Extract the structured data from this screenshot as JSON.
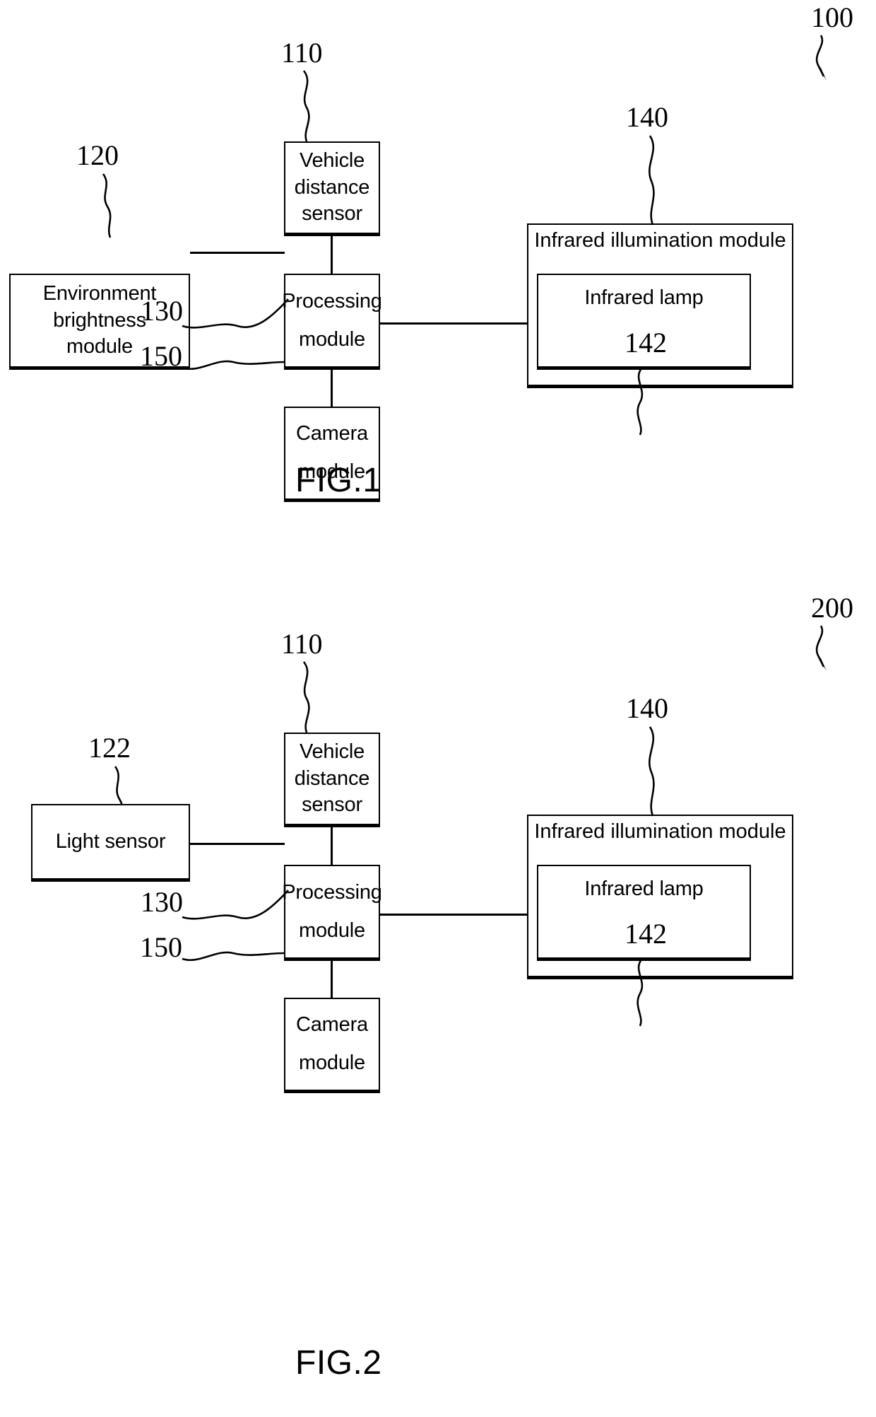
{
  "document": {
    "type": "patent-drawing-sheet",
    "figures": [
      {
        "id": "fig1",
        "caption": "FIG.1",
        "system_ref": "100",
        "blocks": [
          {
            "key": "vehicle_distance_sensor",
            "ref": "110",
            "lines": [
              "Vehicle",
              "distance",
              "sensor"
            ]
          },
          {
            "key": "environment_brightness_module",
            "ref": "120",
            "lines": [
              "Environment",
              "brightness",
              "module"
            ]
          },
          {
            "key": "processing_module",
            "ref": "130",
            "lines": [
              "Processing",
              "module"
            ]
          },
          {
            "key": "infrared_illumination_module",
            "ref": "140",
            "lines": [
              "Infrared illumination",
              "module"
            ]
          },
          {
            "key": "infrared_lamp",
            "ref": "142",
            "lines": [
              "Infrared lamp"
            ]
          },
          {
            "key": "camera_module",
            "ref": "150",
            "lines": [
              "Camera",
              "module"
            ]
          }
        ]
      },
      {
        "id": "fig2",
        "caption": "FIG.2",
        "system_ref": "200",
        "blocks": [
          {
            "key": "vehicle_distance_sensor",
            "ref": "110",
            "lines": [
              "Vehicle",
              "distance",
              "sensor"
            ]
          },
          {
            "key": "light_sensor",
            "ref": "122",
            "lines": [
              "Light sensor"
            ]
          },
          {
            "key": "processing_module",
            "ref": "130",
            "lines": [
              "Processing",
              "module"
            ]
          },
          {
            "key": "infrared_illumination_module",
            "ref": "140",
            "lines": [
              "Infrared illumination",
              "module"
            ]
          },
          {
            "key": "infrared_lamp",
            "ref": "142",
            "lines": [
              "Infrared lamp"
            ]
          },
          {
            "key": "camera_module",
            "ref": "150",
            "lines": [
              "Camera",
              "module"
            ]
          }
        ]
      }
    ]
  },
  "fig1": {
    "caption": "FIG.1",
    "system_ref": "100",
    "vehicle_distance_sensor": {
      "l1": "Vehicle",
      "l2": "distance",
      "l3": "sensor",
      "ref": "110"
    },
    "environment_brightness_module": {
      "l1": "Environment",
      "l2": "brightness",
      "l3": "module",
      "ref": "120"
    },
    "processing_module": {
      "l1": "Processing",
      "l2": "module",
      "ref": "130"
    },
    "infrared_illumination_module": {
      "l1": "Infrared illumination",
      "l2": "module",
      "ref": "140"
    },
    "infrared_lamp": {
      "l1": "Infrared lamp",
      "ref": "142"
    },
    "camera_module": {
      "l1": "Camera",
      "l2": "module",
      "ref": "150"
    }
  },
  "fig2": {
    "caption": "FIG.2",
    "system_ref": "200",
    "vehicle_distance_sensor": {
      "l1": "Vehicle",
      "l2": "distance",
      "l3": "sensor",
      "ref": "110"
    },
    "light_sensor": {
      "l1": "Light sensor",
      "ref": "122"
    },
    "processing_module": {
      "l1": "Processing",
      "l2": "module",
      "ref": "130"
    },
    "infrared_illumination_module": {
      "l1": "Infrared illumination",
      "l2": "module",
      "ref": "140"
    },
    "infrared_lamp": {
      "l1": "Infrared lamp",
      "ref": "142"
    },
    "camera_module": {
      "l1": "Camera",
      "l2": "module",
      "ref": "150"
    }
  },
  "colors": {
    "ink": "#000000",
    "paper": "#ffffff"
  }
}
